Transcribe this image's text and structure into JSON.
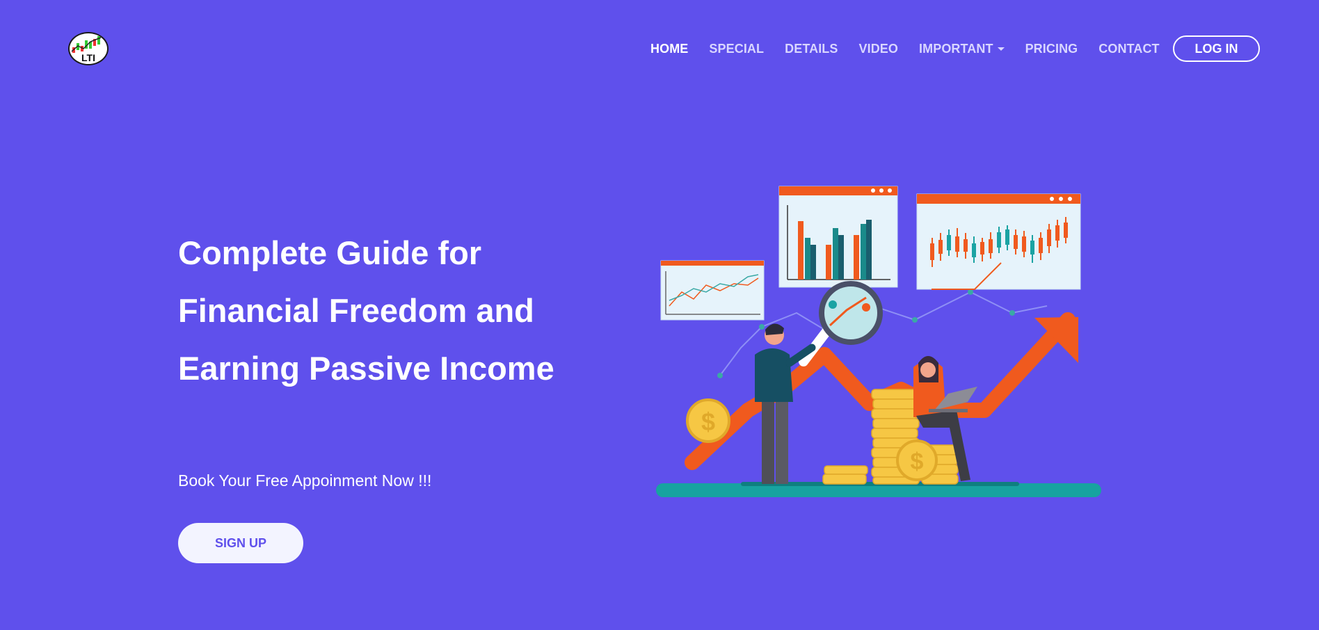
{
  "brand": {
    "logo_text": "LTI"
  },
  "nav": {
    "items": [
      {
        "label": "HOME",
        "active": true
      },
      {
        "label": "SPECIAL"
      },
      {
        "label": "DETAILS"
      },
      {
        "label": "VIDEO"
      },
      {
        "label": "IMPORTANT",
        "dropdown": true
      },
      {
        "label": "PRICING"
      },
      {
        "label": "CONTACT"
      }
    ],
    "login_label": "LOG IN"
  },
  "hero": {
    "title": "Complete Guide for Financial Freedom and Earning Passive Income",
    "subtitle": "Book Your Free Appoinment Now !!!",
    "cta_label": "SIGN UP"
  },
  "colors": {
    "background": "#5f50ec",
    "accent_orange": "#f05a1e",
    "teal": "#1aa3a3",
    "coin_gold": "#f6c744",
    "button_light": "#f3f4ff"
  },
  "icons": [
    "logo-chart-icon",
    "chevron-down-icon",
    "dollar-coin-icon",
    "magnifier-icon",
    "laptop-icon",
    "growth-arrow-icon"
  ]
}
